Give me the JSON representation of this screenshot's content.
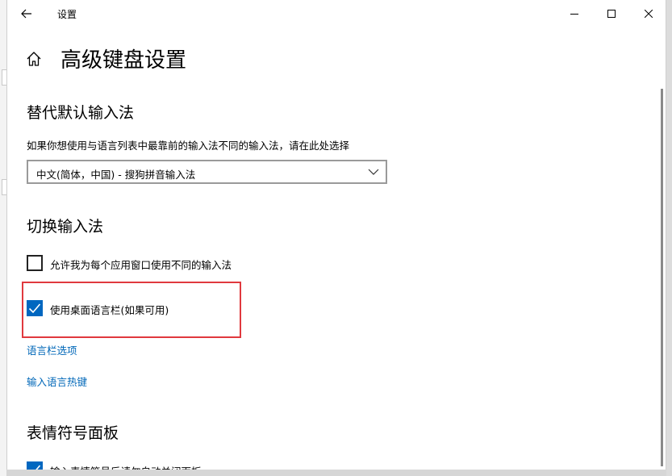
{
  "window": {
    "app_title": "设置",
    "controls": {
      "minimize_icon": "minimize-icon",
      "maximize_icon": "maximize-icon",
      "close_icon": "close-icon"
    }
  },
  "page": {
    "title": "高级键盘设置",
    "home_icon": "home-icon",
    "back_icon": "back-arrow-icon"
  },
  "sections": {
    "override_default": {
      "heading": "替代默认输入法",
      "description": "如果你想使用与语言列表中最靠前的输入法不同的输入法，请在此处选择",
      "dropdown": {
        "selected": "中文(简体，中国) - 搜狗拼音输入法",
        "icon": "chevron-down-icon"
      }
    },
    "switch_input": {
      "heading": "切换输入法",
      "checkboxes": [
        {
          "label": "允许我为每个应用窗口使用不同的输入法",
          "checked": false
        },
        {
          "label": "使用桌面语言栏(如果可用)",
          "checked": true
        }
      ],
      "links": {
        "language_bar_options": "语言栏选项",
        "input_hotkeys": "输入语言热键"
      }
    },
    "emoji_panel": {
      "heading": "表情符号面板",
      "checkbox": {
        "label": "输入表情符号后请勿自动关闭面板",
        "checked": true
      }
    }
  },
  "colors": {
    "accent": "#0067c0",
    "link": "#0067b8",
    "highlight_border": "#e0393e"
  }
}
